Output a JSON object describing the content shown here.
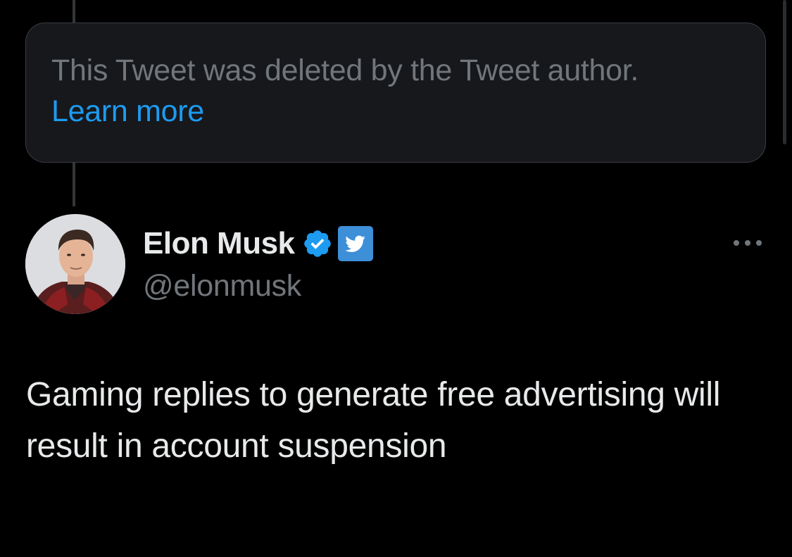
{
  "deleted_notice": {
    "text": "This Tweet was deleted by the Tweet author.",
    "link_label": "Learn more"
  },
  "tweet": {
    "author_name": "Elon Musk",
    "author_handle": "@elonmusk",
    "text": "Gaming replies to generate free advertising will result in account suspension"
  },
  "icons": {
    "verified": "verified-badge-icon",
    "affiliate": "twitter-bird-icon",
    "more": "more-horizontal-icon",
    "avatar": "avatar-photo"
  },
  "colors": {
    "background": "#000000",
    "card_background": "#16181c",
    "muted_text": "#71767b",
    "primary_text": "#e7e9ea",
    "link": "#1d9bf0"
  }
}
